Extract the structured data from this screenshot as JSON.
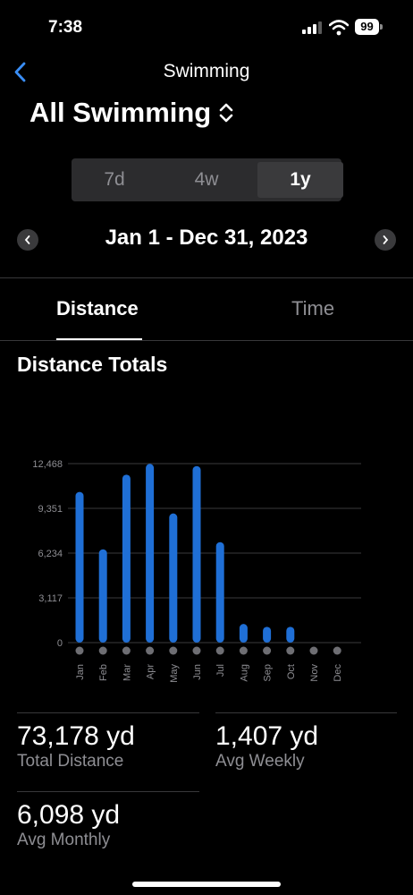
{
  "status_bar": {
    "time": "7:38",
    "battery": "99"
  },
  "nav": {
    "title": "Swimming",
    "back_icon": "chevron-left-icon"
  },
  "filter": {
    "label": "All Swimming",
    "icon": "chevron-up-down-icon"
  },
  "range_selector": {
    "options": [
      "7d",
      "4w",
      "1y"
    ],
    "selected": "1y"
  },
  "date_range": {
    "label": "Jan 1 - Dec 31, 2023"
  },
  "tabs": [
    {
      "label": "Distance",
      "active": true
    },
    {
      "label": "Time",
      "active": false
    }
  ],
  "section_title": "Distance Totals",
  "chart_data": {
    "type": "bar",
    "title": "",
    "xlabel": "",
    "ylabel": "",
    "categories": [
      "Jan",
      "Feb",
      "Mar",
      "Apr",
      "May",
      "Jun",
      "Jul",
      "Aug",
      "Sep",
      "Oct",
      "Nov",
      "Dec"
    ],
    "values": [
      10500,
      6500,
      11700,
      12450,
      9000,
      12300,
      7000,
      1300,
      1100,
      1100,
      0,
      0
    ],
    "y_ticks": [
      "0",
      "3,117",
      "6,234",
      "9,351",
      "12,468"
    ],
    "ylim": [
      0,
      12468
    ],
    "grid": true,
    "bar_color": "#1f6fd6"
  },
  "stats": [
    {
      "value": "73,178 yd",
      "label": "Total Distance"
    },
    {
      "value": "1,407 yd",
      "label": "Avg Weekly"
    },
    {
      "value": "6,098 yd",
      "label": "Avg Monthly"
    }
  ]
}
